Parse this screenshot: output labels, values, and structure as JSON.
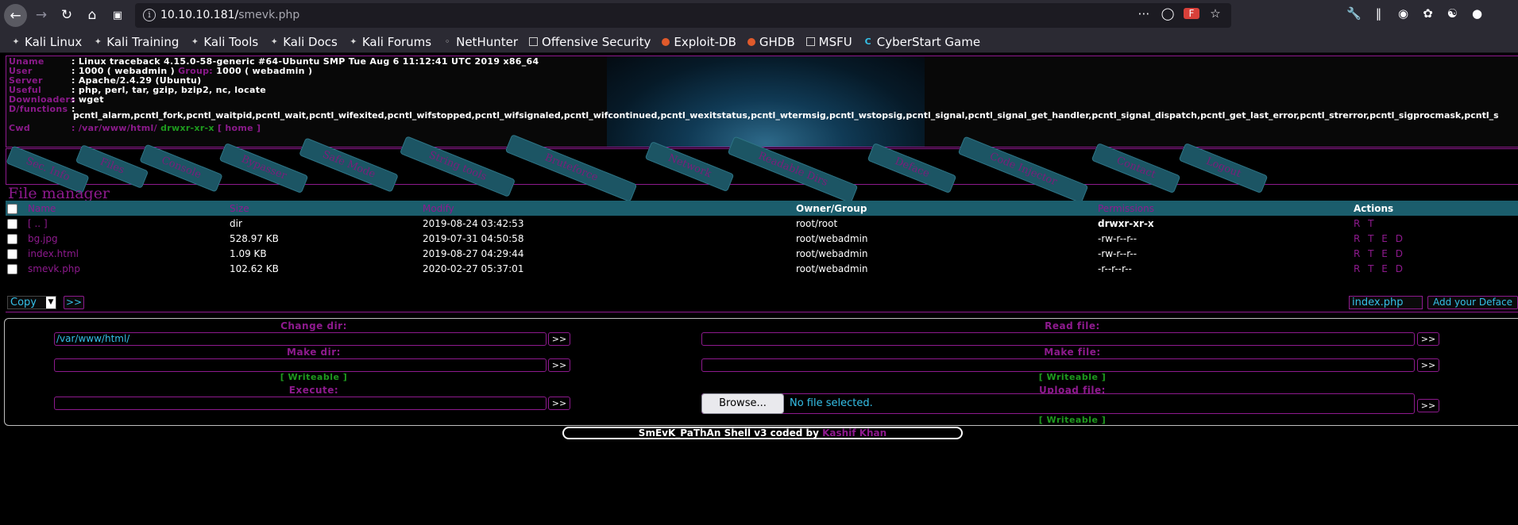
{
  "browser": {
    "url_host": "10.10.10.181/",
    "url_path": "smevk.php",
    "bookmarks": [
      "Kali Linux",
      "Kali Training",
      "Kali Tools",
      "Kali Docs",
      "Kali Forums",
      "NetHunter",
      "Offensive Security",
      "Exploit-DB",
      "GHDB",
      "MSFU",
      "CyberStart Game"
    ]
  },
  "info": {
    "uname_label": "Uname",
    "uname": ": Linux traceback 4.15.0-58-generic #64-Ubuntu SMP Tue Aug 6 11:12:41 UTC 2019 x86_64",
    "user_label": "User",
    "user_a": ": 1000 ( webadmin )",
    "group_label": "Group:",
    "user_b": "1000 ( webadmin )",
    "server_label": "Server",
    "server": ": Apache/2.4.29 (Ubuntu)",
    "useful_label": "Useful",
    "useful": ": php, perl, tar, gzip, bzip2, nc, locate",
    "downloaders_label": "Downloaders",
    "downloaders": ": wget",
    "dfunctions_label": "D/functions",
    "dfunctions_colon": ":",
    "functions": "pcntl_alarm,pcntl_fork,pcntl_waitpid,pcntl_wait,pcntl_wifexited,pcntl_wifstopped,pcntl_wifsignaled,pcntl_wifcontinued,pcntl_wexitstatus,pcntl_wtermsig,pcntl_wstopsig,pcntl_signal,pcntl_signal_get_handler,pcntl_signal_dispatch,pcntl_get_last_error,pcntl_strerror,pcntl_sigprocmask,pcntl_s",
    "cwd_label": "Cwd",
    "cwd": ": /var/www/html/",
    "cwd_perm": "drwxr-xr-x",
    "cwd_home": "[ home ]"
  },
  "menu": [
    "Sec. Info",
    "Files",
    "Console",
    "Bypasser",
    "Safe Mode",
    "String tools",
    "Bruteforce",
    "Network",
    "Readable Dirs",
    "Deface",
    "Code Injector",
    "Contact",
    "Logout"
  ],
  "file_manager": {
    "title": "File manager",
    "columns": {
      "name": "Name",
      "size": "Size",
      "modify": "Modify",
      "owner": "Owner/Group",
      "perm": "Permissions",
      "actions": "Actions"
    },
    "rows": [
      {
        "name": "[ .. ]",
        "size": "dir",
        "modify": "2019-08-24 03:42:53",
        "owner": "root/root",
        "perm": "drwxr-xr-x",
        "actions": "R T"
      },
      {
        "name": "bg.jpg",
        "size": "528.97 KB",
        "modify": "2019-07-31 04:50:58",
        "owner": "root/webadmin",
        "perm": "-rw-r--r--",
        "actions": "R T E D"
      },
      {
        "name": "index.html",
        "size": "1.09 KB",
        "modify": "2019-08-27 04:29:44",
        "owner": "root/webadmin",
        "perm": "-rw-r--r--",
        "actions": "R T E D"
      },
      {
        "name": "smevk.php",
        "size": "102.62 KB",
        "modify": "2020-02-27 05:37:01",
        "owner": "root/webadmin",
        "perm": "-r--r--r--",
        "actions": "R T E D"
      }
    ],
    "copy_option": "Copy",
    "go": ">>",
    "deface_file": "index.php",
    "deface_button": "Add your Deface"
  },
  "tools": {
    "change_dir": "Change dir:",
    "change_dir_value": "/var/www/html/",
    "read_file": "Read file:",
    "make_dir": "Make dir:",
    "make_file": "Make file:",
    "writeable": "[ Writeable ]",
    "execute": "Execute:",
    "upload_file": "Upload file:",
    "browse": "Browse...",
    "no_file": "No file selected.",
    "go": ">>"
  },
  "footer": {
    "text": "SmEvK_PaThAn Shell v3 coded by",
    "author": "Kashif Khan"
  }
}
